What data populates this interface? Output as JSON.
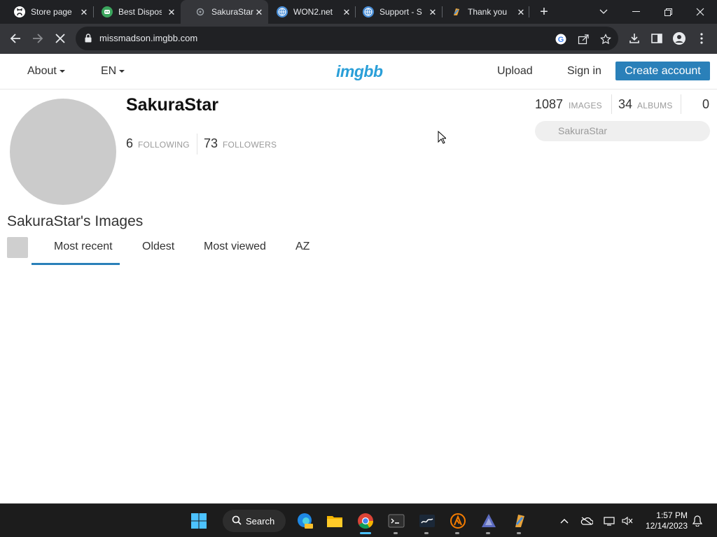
{
  "browser": {
    "tabs": [
      {
        "title": "Store page",
        "icon": "github-icon",
        "color": "#ffffff"
      },
      {
        "title": "Best Dispos",
        "icon": "discord-icon",
        "color": "#3ba55d"
      },
      {
        "title": "SakuraStar",
        "icon": "imgbb-icon",
        "color": "#9aa0a6",
        "active": true
      },
      {
        "title": "WON2.net",
        "icon": "globe-icon",
        "color": "#4a8fd8"
      },
      {
        "title": "Support - S",
        "icon": "steam-globe-icon",
        "color": "#4a8fd8"
      },
      {
        "title": "Thank you",
        "icon": "paint-icon",
        "color": "#e8a33a"
      }
    ],
    "url": "missmadson.imgbb.com"
  },
  "site": {
    "nav": {
      "about": "About",
      "lang": "EN",
      "logo": "imgbb",
      "upload": "Upload",
      "sign_in": "Sign in",
      "create_account": "Create account"
    },
    "profile": {
      "username": "SakuraStar",
      "following_count": "6",
      "following_label": "FOLLOWING",
      "followers_count": "73",
      "followers_label": "FOLLOWERS",
      "images_count": "1087",
      "images_label": "IMAGES",
      "albums_count": "34",
      "albums_label": "ALBUMS",
      "likes_count": "0",
      "search_placeholder": "SakuraStar"
    },
    "gallery": {
      "title": "SakuraStar's Images",
      "sort_tabs": [
        "Most recent",
        "Oldest",
        "Most viewed",
        "AZ"
      ],
      "active_tab": "Most recent"
    },
    "colors": {
      "accent": "#2a80b9",
      "logo": "#2a9fd8"
    }
  },
  "taskbar": {
    "search_label": "Search",
    "time": "1:57 PM",
    "date": "12/14/2023"
  }
}
